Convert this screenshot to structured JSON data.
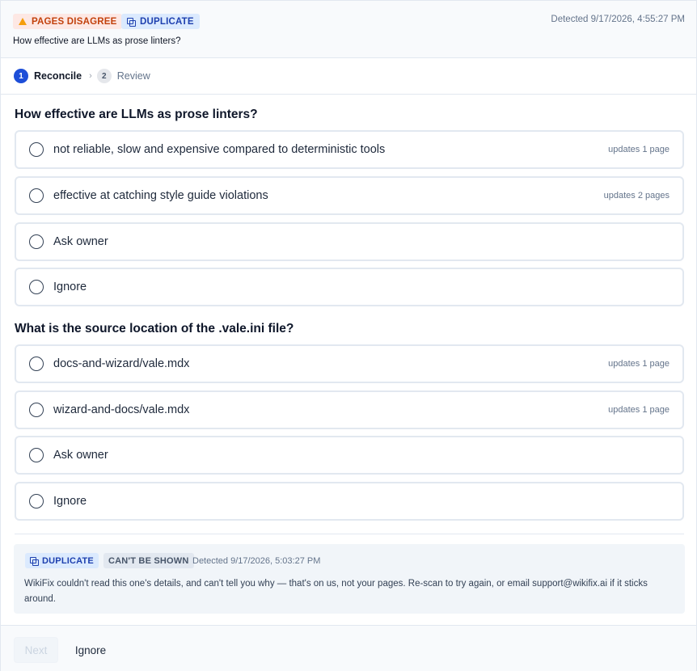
{
  "header": {
    "badge_conflict": "PAGES DISAGREE",
    "badge_duplicate": "DUPLICATE",
    "title": "How effective are LLMs as prose linters?",
    "detected": "Detected 9/17/2026, 4:55:27 PM"
  },
  "steps": [
    {
      "num": "1",
      "label": "Reconcile",
      "active": true
    },
    {
      "num": "2",
      "label": "Review",
      "active": false
    }
  ],
  "questions": [
    {
      "title": "How effective are LLMs as prose linters?",
      "options": [
        {
          "label": "not reliable, slow and expensive compared to deterministic tools",
          "meta": "updates 1 page"
        },
        {
          "label": "effective at catching style guide violations",
          "meta": "updates 2 pages"
        },
        {
          "label": "Ask owner",
          "meta": ""
        },
        {
          "label": "Ignore",
          "meta": ""
        }
      ]
    },
    {
      "title": "What is the source location of the .vale.ini file?",
      "options": [
        {
          "label": "docs-and-wizard/vale.mdx",
          "meta": "updates 1 page"
        },
        {
          "label": "wizard-and-docs/vale.mdx",
          "meta": "updates 1 page"
        },
        {
          "label": "Ask owner",
          "meta": ""
        },
        {
          "label": "Ignore",
          "meta": ""
        }
      ]
    }
  ],
  "notice": {
    "badge_duplicate": "DUPLICATE",
    "badge_cant": "CAN'T BE SHOWN",
    "detected": "Detected 9/17/2026, 5:03:27 PM",
    "message": "WikiFix couldn't read this one's details, and can't tell you why — that's on us, not your pages. Re-scan to try again, or email support@wikifix.ai if it sticks around."
  },
  "footer": {
    "next_label": "Next",
    "ignore_label": "Ignore"
  },
  "colors": {
    "accent": "#1d4ed8",
    "warn_bg": "#fde8e4",
    "warn_text": "#c2410c",
    "dup_bg": "#dbeafe",
    "dup_text": "#1e40af"
  }
}
